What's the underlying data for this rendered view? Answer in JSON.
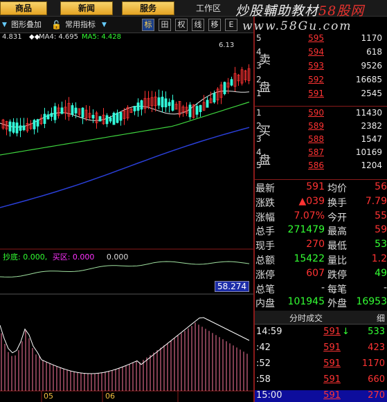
{
  "menu": {
    "items": [
      "商品",
      "新闻",
      "服务"
    ],
    "workzone": "工作区"
  },
  "watermark": {
    "line1_a": "炒股輔助教材",
    "line1_b": "58股网",
    "line2": "www.58Gu.com"
  },
  "toolbar": {
    "overlay": "图形叠加",
    "indicators": "常用指标",
    "buttons": [
      "标",
      "田",
      "权",
      "线",
      "移",
      "E"
    ]
  },
  "ma": {
    "ma3": "4.831",
    "ma4": "MA4: 4.695",
    "ma5": "MA5: 4.428",
    "peak_label": "6.13"
  },
  "indicator": {
    "label1": "抄底: 0.000,",
    "label2": "买区: 0.000",
    "label3": "0.000",
    "current_value": "58.274"
  },
  "x_axis": {
    "labels": [
      "05",
      "06"
    ]
  },
  "order_book": {
    "sell_label": [
      "卖",
      "盘"
    ],
    "buy_label": [
      "买",
      "盘"
    ],
    "sell": [
      {
        "level": "5",
        "price": "595",
        "volume": "1170"
      },
      {
        "level": "4",
        "price": "594",
        "volume": "618"
      },
      {
        "level": "3",
        "price": "593",
        "volume": "9526"
      },
      {
        "level": "2",
        "price": "592",
        "volume": "16685"
      },
      {
        "level": "1",
        "price": "591",
        "volume": "2545"
      }
    ],
    "buy": [
      {
        "level": "1",
        "price": "590",
        "volume": "11430"
      },
      {
        "level": "2",
        "price": "589",
        "volume": "2382"
      },
      {
        "level": "3",
        "price": "588",
        "volume": "1547"
      },
      {
        "level": "4",
        "price": "587",
        "volume": "10169"
      },
      {
        "level": "5",
        "price": "586",
        "volume": "1204"
      }
    ]
  },
  "stats": [
    {
      "l": "最新",
      "v": "591",
      "l2": "均价",
      "v2": "56"
    },
    {
      "l": "涨跌",
      "v": "▲039",
      "l2": "换手",
      "v2": "7.79"
    },
    {
      "l": "涨幅",
      "v": "7.07%",
      "l2": "今开",
      "v2": "55"
    },
    {
      "l": "总手",
      "v": "271479",
      "l2": "最高",
      "v2": "59"
    },
    {
      "l": "现手",
      "v": "270",
      "l2": "最低",
      "v2": "53"
    },
    {
      "l": "总额",
      "v": "15422",
      "l2": "量比",
      "v2": "1.2"
    },
    {
      "l": "涨停",
      "v": "607",
      "l2": "跌停",
      "v2": "49"
    },
    {
      "l": "总笔",
      "v": "-",
      "l2": "每笔",
      "v2": "-"
    },
    {
      "l": "内盘",
      "v": "101945",
      "l2": "外盘",
      "v2": "16953"
    }
  ],
  "ticks_header": {
    "title": "分时成交",
    "right": "细"
  },
  "ticks": [
    {
      "time": "14:59",
      "price": "591",
      "arrow": "↓",
      "vol": "533"
    },
    {
      "time": ":42",
      "price": "591",
      "arrow": "",
      "vol": "423"
    },
    {
      "time": ":52",
      "price": "591",
      "arrow": "",
      "vol": "1170"
    },
    {
      "time": ":58",
      "price": "591",
      "arrow": "",
      "vol": "660"
    },
    {
      "time": "15:00",
      "price": "591",
      "arrow": "",
      "vol": "270"
    }
  ],
  "colors": {
    "up": "#ff3333",
    "down": "#33ff33",
    "accent": "#f0c040"
  }
}
